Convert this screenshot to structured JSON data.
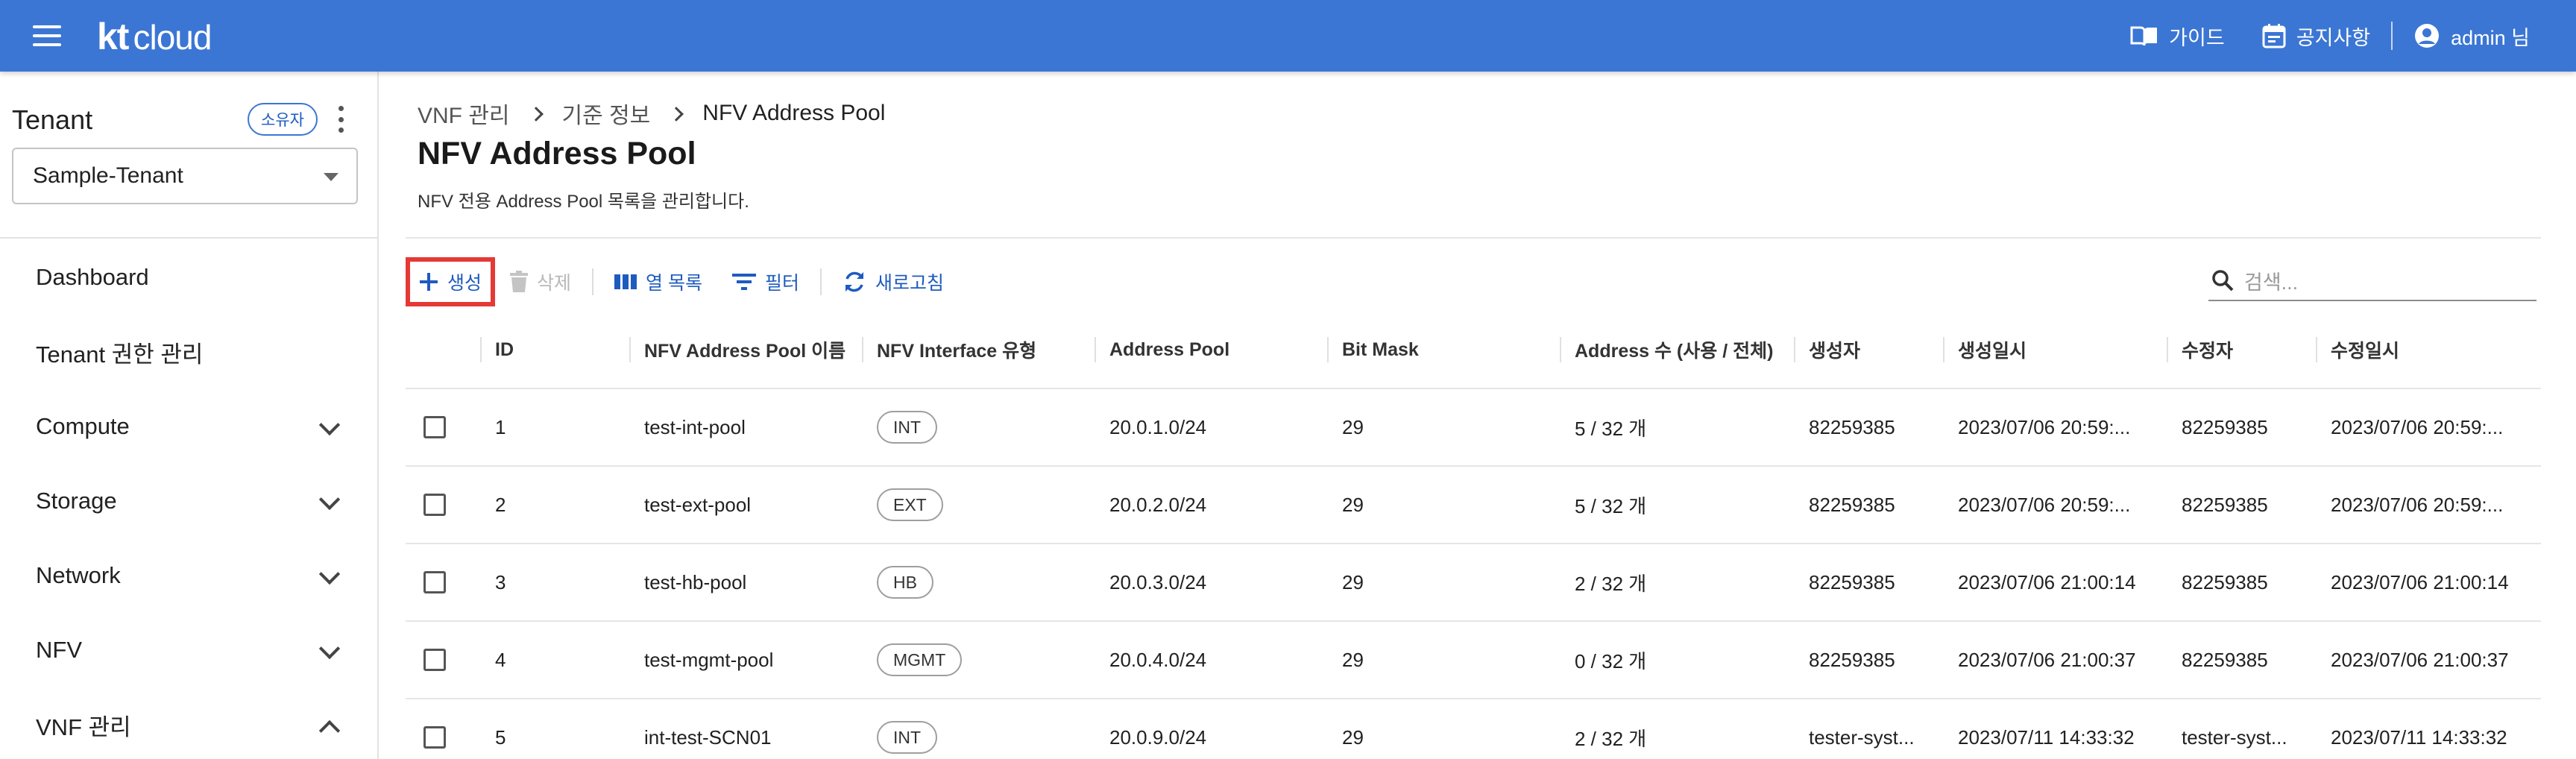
{
  "header": {
    "logo_kt": "kt",
    "logo_cloud": "cloud",
    "guide_label": "가이드",
    "notice_label": "공지사항",
    "user_label": "admin 님"
  },
  "sidebar": {
    "tenant_title": "Tenant",
    "owner_badge": "소유자",
    "tenant_selected": "Sample-Tenant",
    "items": [
      {
        "label": "Dashboard",
        "chevron": ""
      },
      {
        "label": "Tenant 권한 관리",
        "chevron": ""
      },
      {
        "label": "Compute",
        "chevron": "down"
      },
      {
        "label": "Storage",
        "chevron": "down"
      },
      {
        "label": "Network",
        "chevron": "down"
      },
      {
        "label": "NFV",
        "chevron": "down"
      },
      {
        "label": "VNF 관리",
        "chevron": "up"
      }
    ]
  },
  "breadcrumb": [
    "VNF 관리",
    "기준 정보",
    "NFV Address Pool"
  ],
  "page": {
    "title": "NFV Address Pool",
    "description": "NFV 전용 Address Pool 목록을 관리합니다."
  },
  "toolbar": {
    "create_label": "생성",
    "delete_label": "삭제",
    "columns_label": "열 목록",
    "filter_label": "필터",
    "refresh_label": "새로고침"
  },
  "search": {
    "placeholder": "검색..."
  },
  "table": {
    "columns": [
      "ID",
      "NFV Address Pool 이름",
      "NFV Interface 유형",
      "Address Pool",
      "Bit Mask",
      "Address 수 (사용 / 전체)",
      "생성자",
      "생성일시",
      "수정자",
      "수정일시"
    ],
    "rows": [
      [
        "1",
        "test-int-pool",
        "INT",
        "20.0.1.0/24",
        "29",
        "5 / 32 개",
        "82259385",
        "2023/07/06 20:59:...",
        "82259385",
        "2023/07/06 20:59:..."
      ],
      [
        "2",
        "test-ext-pool",
        "EXT",
        "20.0.2.0/24",
        "29",
        "5 / 32 개",
        "82259385",
        "2023/07/06 20:59:...",
        "82259385",
        "2023/07/06 20:59:..."
      ],
      [
        "3",
        "test-hb-pool",
        "HB",
        "20.0.3.0/24",
        "29",
        "2 / 32 개",
        "82259385",
        "2023/07/06 21:00:14",
        "82259385",
        "2023/07/06 21:00:14"
      ],
      [
        "4",
        "test-mgmt-pool",
        "MGMT",
        "20.0.4.0/24",
        "29",
        "0 / 32 개",
        "82259385",
        "2023/07/06 21:00:37",
        "82259385",
        "2023/07/06 21:00:37"
      ],
      [
        "5",
        "int-test-SCN01",
        "INT",
        "20.0.9.0/24",
        "29",
        "2 / 32 개",
        "tester-syst...",
        "2023/07/11 14:33:32",
        "tester-syst...",
        "2023/07/11 14:33:32"
      ]
    ]
  },
  "colors": {
    "header_bg": "#3b76d4",
    "accent": "#1e5bbf",
    "highlight": "#e53935"
  }
}
